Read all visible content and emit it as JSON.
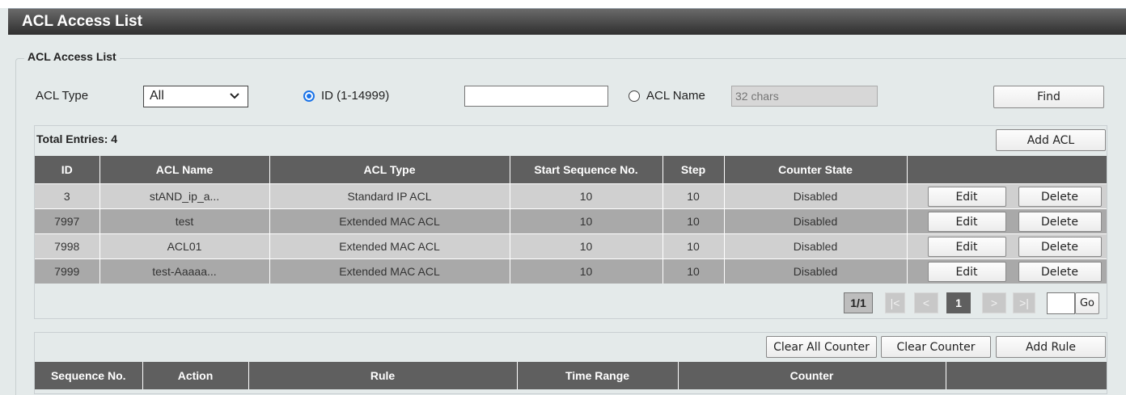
{
  "header": {
    "title": "ACL Access List"
  },
  "section": {
    "legend": "ACL Access List"
  },
  "filter": {
    "acl_type_label": "ACL Type",
    "acl_type_value": "All",
    "id_radio_label": "ID (1-14999)",
    "id_value": "",
    "name_radio_label": "ACL Name",
    "name_placeholder": "32 chars",
    "find_label": "Find",
    "selected": "id"
  },
  "acl_table": {
    "total_label": "Total Entries: 4",
    "add_label": "Add ACL",
    "columns": [
      "ID",
      "ACL Name",
      "ACL Type",
      "Start Sequence No.",
      "Step",
      "Counter State",
      ""
    ],
    "rows": [
      {
        "id": "3",
        "name": "stAND_ip_a...",
        "type": "Standard IP ACL",
        "start_seq": "10",
        "step": "10",
        "counter_state": "Disabled"
      },
      {
        "id": "7997",
        "name": "test",
        "type": "Extended MAC ACL",
        "start_seq": "10",
        "step": "10",
        "counter_state": "Disabled"
      },
      {
        "id": "7998",
        "name": "ACL01",
        "type": "Extended MAC ACL",
        "start_seq": "10",
        "step": "10",
        "counter_state": "Disabled"
      },
      {
        "id": "7999",
        "name": "test-Aaaaa...",
        "type": "Extended MAC ACL",
        "start_seq": "10",
        "step": "10",
        "counter_state": "Disabled"
      }
    ],
    "edit_label": "Edit",
    "delete_label": "Delete"
  },
  "pagination": {
    "page_info": "1/1",
    "first": "|<",
    "prev": "<",
    "current": "1",
    "next": ">",
    "last": ">|",
    "go_value": "",
    "go_label": "Go"
  },
  "rule_table": {
    "clear_all_label": "Clear All Counter",
    "clear_label": "Clear Counter",
    "add_rule_label": "Add Rule",
    "columns": [
      "Sequence No.",
      "Action",
      "Rule",
      "Time Range",
      "Counter",
      ""
    ]
  }
}
